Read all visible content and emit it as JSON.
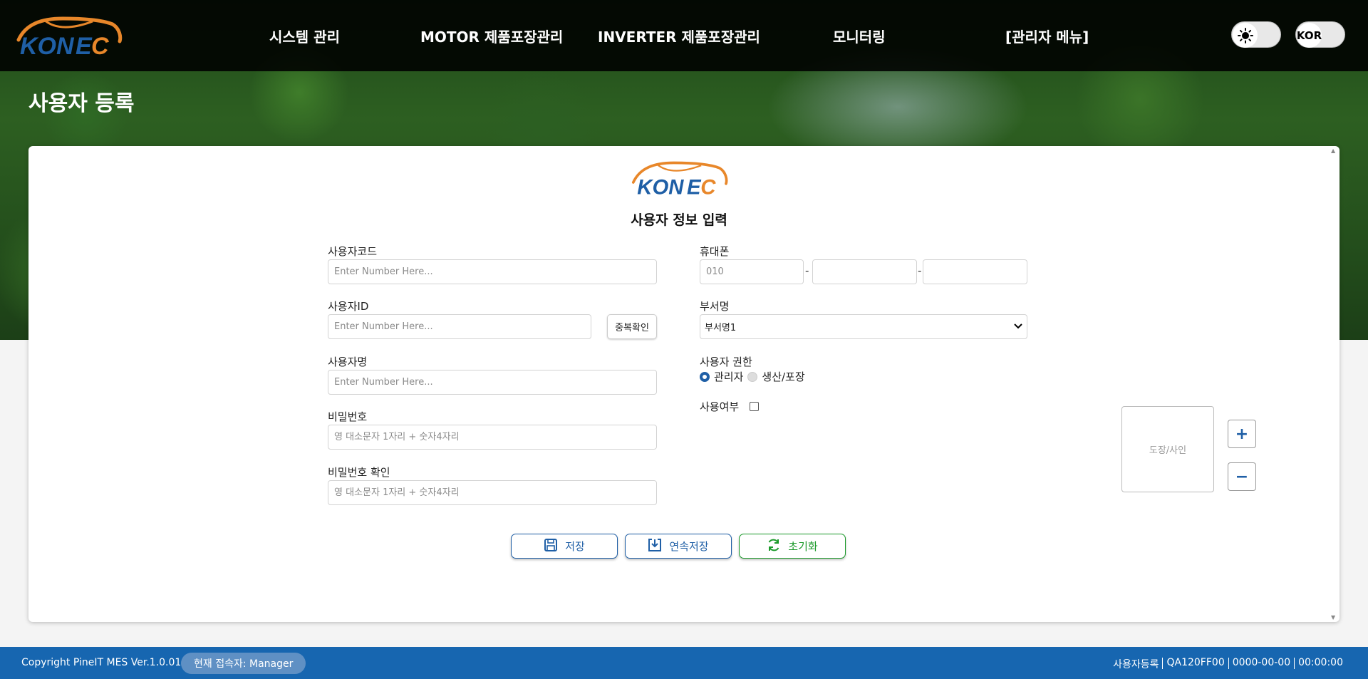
{
  "app": {
    "logo_text": "KONEC",
    "brand_colors": {
      "blue": "#1f5fa6",
      "orange": "#e8872a",
      "green": "#1b9a2a",
      "footer": "#1766b0"
    }
  },
  "nav": {
    "items": [
      {
        "label": "시스템 관리"
      },
      {
        "label": "MOTOR 제품포장관리"
      },
      {
        "label": "INVERTER 제품포장관리"
      },
      {
        "label": "모니터링"
      },
      {
        "label": "[관리자 메뉴]"
      }
    ],
    "theme_toggle_icon": "sun-icon",
    "lang_toggle_label": "KOR"
  },
  "page": {
    "title": "사용자 등록"
  },
  "form": {
    "title": "사용자 정보 입력",
    "user_code": {
      "label": "사용자코드",
      "placeholder": "Enter Number Here..."
    },
    "user_id": {
      "label": "사용자ID",
      "placeholder": "Enter Number Here...",
      "dup_check_label": "중복확인"
    },
    "user_name": {
      "label": "사용자명",
      "placeholder": "Enter Number Here..."
    },
    "password": {
      "label": "비밀번호",
      "placeholder": "영 대소문자 1자리 + 숫자4자리"
    },
    "password_confirm": {
      "label": "비밀번호 확인",
      "placeholder": "영 대소문자 1자리 + 숫자4자리"
    },
    "phone": {
      "label": "휴대폰",
      "part1_placeholder": "010",
      "dash": "-"
    },
    "department": {
      "label": "부서명",
      "selected": "부서명1"
    },
    "role": {
      "label": "사용자 권한",
      "options": [
        {
          "label": "관리자",
          "checked": true
        },
        {
          "label": "생산/포장",
          "checked": false
        }
      ]
    },
    "active": {
      "label": "사용여부",
      "checked": false
    },
    "stamp": {
      "label": "도장/사인",
      "plus": "+",
      "minus": "−"
    },
    "buttons": {
      "save": "저장",
      "save_continue": "연속저장",
      "reset": "초기화"
    }
  },
  "footer": {
    "copyright": "Copyright PineIT MES Ver.1.0.01",
    "current_user": "현재 접속자: Manager",
    "screen": "사용자등록",
    "code": "QA120FF00",
    "date": "0000-00-00",
    "time": "00:00:00"
  }
}
